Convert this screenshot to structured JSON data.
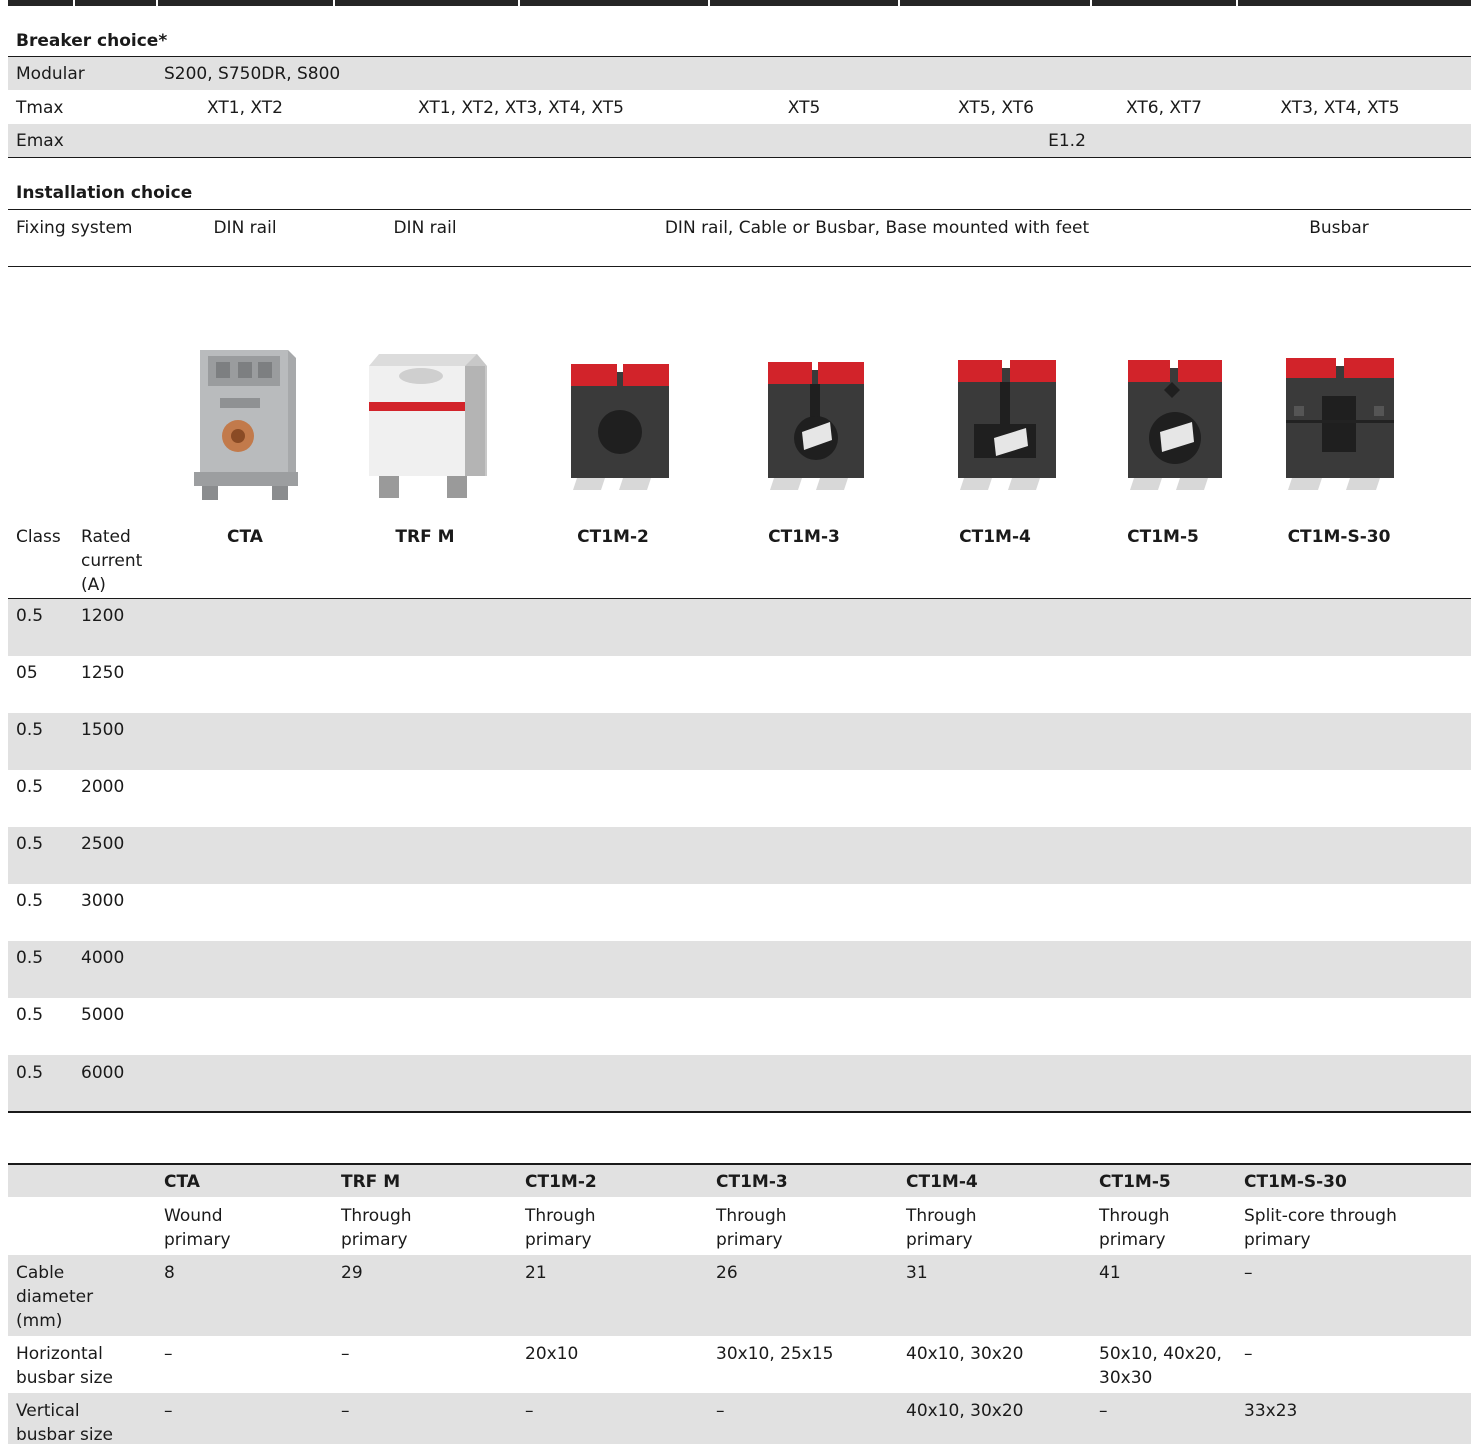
{
  "breaker": {
    "title": "Breaker choice*",
    "rows": [
      {
        "label": "Modular",
        "values": [
          "S200, S750DR, S800"
        ]
      },
      {
        "label": "Tmax",
        "values": [
          "XT1, XT2",
          "XT1, XT2, XT3, XT4, XT5",
          "XT5",
          "XT5, XT6",
          "XT6, XT7",
          "XT3, XT4, XT5"
        ]
      },
      {
        "label": "Emax",
        "values": [
          "E1.2"
        ]
      }
    ]
  },
  "installation": {
    "title": "Installation choice",
    "label": "Fixing system",
    "values": [
      "DIN rail",
      "DIN rail",
      "DIN rail, Cable or Busbar, Base mounted with feet",
      "Busbar"
    ]
  },
  "products": {
    "header": {
      "class": "Class",
      "rated": "Rated current (A)"
    },
    "names": [
      "CTA",
      "TRF M",
      "CT1M-2",
      "CT1M-3",
      "CT1M-4",
      "CT1M-5",
      "CT1M-S-30"
    ],
    "images": [
      "cta-transformer",
      "trf-m-transformer",
      "ct1m-2-transformer",
      "ct1m-3-transformer",
      "ct1m-4-transformer",
      "ct1m-5-transformer",
      "ct1m-s-30-transformer"
    ],
    "rows": [
      {
        "class": "0.5",
        "rated": "1200"
      },
      {
        "class": "05",
        "rated": "1250"
      },
      {
        "class": "0.5",
        "rated": "1500"
      },
      {
        "class": "0.5",
        "rated": "2000"
      },
      {
        "class": "0.5",
        "rated": "2500"
      },
      {
        "class": "0.5",
        "rated": "3000"
      },
      {
        "class": "0.5",
        "rated": "4000"
      },
      {
        "class": "0.5",
        "rated": "5000"
      },
      {
        "class": "0.5",
        "rated": "6000"
      }
    ]
  },
  "specs": {
    "columns": [
      "CTA",
      "TRF M",
      "CT1M-2",
      "CT1M-3",
      "CT1M-4",
      "CT1M-5",
      "CT1M-S-30"
    ],
    "types": [
      "Wound primary",
      "Through primary",
      "Through primary",
      "Through primary",
      "Through primary",
      "Through primary",
      "Split-core through primary"
    ],
    "rows": [
      {
        "label": "Cable diameter (mm)",
        "values": [
          "8",
          "29",
          "21",
          "26",
          "31",
          "41",
          "–"
        ]
      },
      {
        "label": "Horizontal busbar size",
        "values": [
          "–",
          "–",
          "20x10",
          "30x10, 25x15",
          "40x10, 30x20",
          "50x10, 40x20, 30x30",
          "–"
        ]
      },
      {
        "label": "Vertical busbar size",
        "values": [
          "–",
          "–",
          "–",
          "–",
          "40x10, 30x20",
          "–",
          "33x23"
        ]
      }
    ]
  },
  "colors": {
    "grey_band": "#e1e1e1",
    "rule": "#1a1a1a",
    "ct_red": "#d2232a",
    "ct_body": "#3a3a3a"
  }
}
